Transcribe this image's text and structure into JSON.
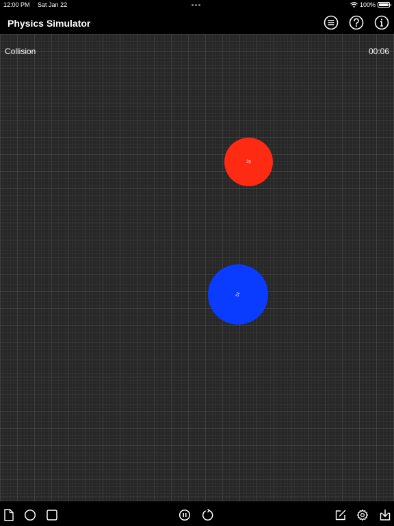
{
  "status_bar": {
    "time": "12:00 PM",
    "date": "Sat Jan 22",
    "battery": "100%"
  },
  "nav": {
    "title": "Physics Simulator",
    "icons": [
      "list-icon",
      "help-icon",
      "info-icon"
    ]
  },
  "simulation": {
    "name": "Collision",
    "timer": "00:06",
    "grid": true,
    "balls": [
      {
        "label": "20",
        "color": "#ff2a12"
      },
      {
        "label": "51",
        "color": "#0a3cff"
      }
    ]
  },
  "toolbar": {
    "left_icons": [
      "new-document-icon",
      "circle-shape-icon",
      "square-shape-icon"
    ],
    "center_icons": [
      "pause-icon",
      "reset-icon"
    ],
    "right_icons": [
      "edit-icon",
      "settings-icon",
      "save-icon"
    ]
  },
  "colors": {
    "background": "#000000",
    "canvas": "#272727",
    "red_ball": "#ff2a12",
    "blue_ball": "#0a3cff"
  }
}
